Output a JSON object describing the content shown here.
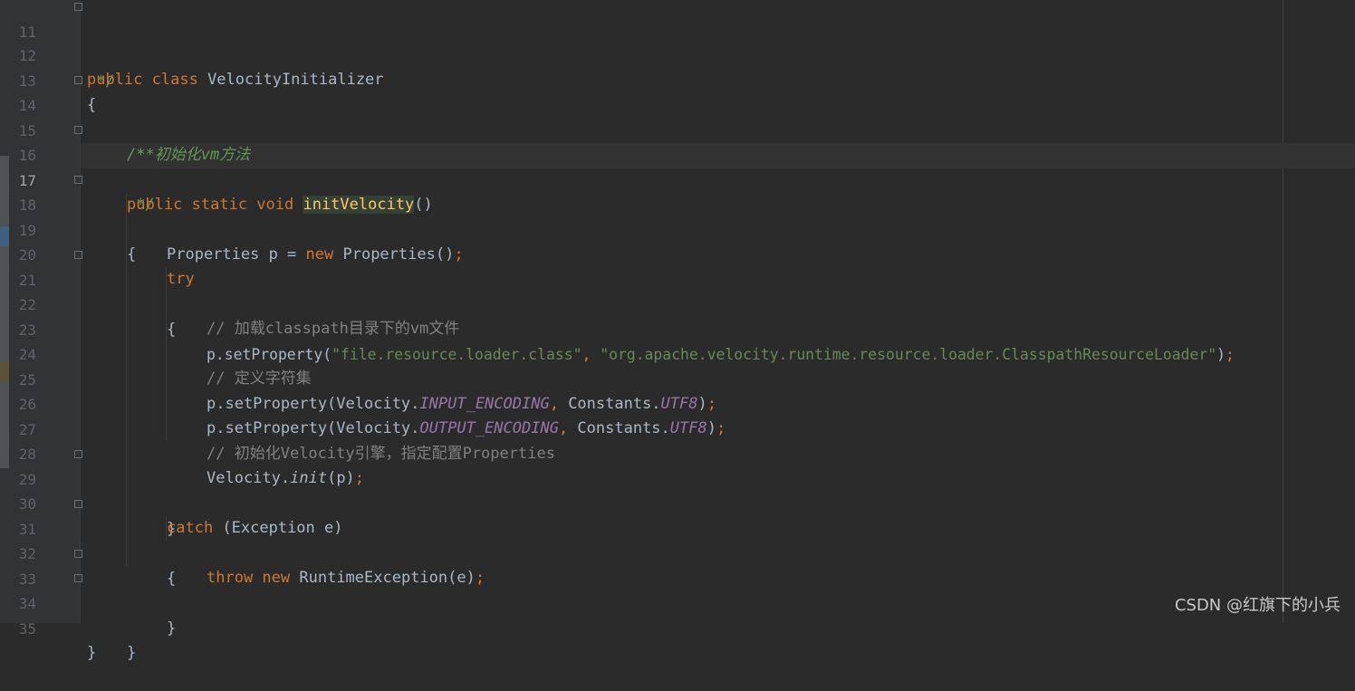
{
  "editor": {
    "line_numbers": [
      "11",
      "12",
      "13",
      "14",
      "15",
      "16",
      "17",
      "18",
      "19",
      "20",
      "21",
      "22",
      "23",
      "24",
      "25",
      "26",
      "27",
      "28",
      "29",
      "30",
      "31",
      "32",
      "33",
      "34",
      "35"
    ],
    "active_line": "17",
    "lines": {
      "l11": {
        "doc": " */"
      },
      "l12": {
        "kw": "public class ",
        "name": "VelocityInitializer"
      },
      "l13": {
        "text": "{"
      },
      "l14": {
        "doc": "/**"
      },
      "l15": {
        "doc": " * 初始化vm方法"
      },
      "l16": {
        "doc": " */"
      },
      "l17": {
        "kw": "public static void ",
        "fn": "initVelocity",
        "rest": "()"
      },
      "l18": {
        "text": "{"
      },
      "l19": {
        "a": "Properties p = ",
        "kw": "new ",
        "b": "Properties()",
        "semi": ";"
      },
      "l20": {
        "kw": "try"
      },
      "l21": {
        "text": "{"
      },
      "l22": {
        "comment": "// 加载classpath目录下的vm文件"
      },
      "l23": {
        "a": "p.setProperty(",
        "s1": "\"file.resource.loader.class\"",
        "comma": ", ",
        "s2": "\"org.apache.velocity.runtime.resource.loader.ClasspathResourceLoader\"",
        "b": ")",
        "semi": ";"
      },
      "l24": {
        "comment": "// 定义字符集"
      },
      "l25": {
        "a": "p.setProperty(Velocity.",
        "c1": "INPUT_ENCODING",
        "comma": ", ",
        "b": "Constants.",
        "c2": "UTF8",
        "d": ")",
        "semi": ";"
      },
      "l26": {
        "a": "p.setProperty(Velocity.",
        "c1": "OUTPUT_ENCODING",
        "comma": ", ",
        "b": "Constants.",
        "c2": "UTF8",
        "d": ")",
        "semi": ";"
      },
      "l27": {
        "comment": "// 初始化Velocity引擎，指定配置Properties"
      },
      "l28": {
        "a": "Velocity.",
        "it": "init",
        "b": "(p)",
        "semi": ";"
      },
      "l29": {
        "text": "}"
      },
      "l30": {
        "kw": "catch ",
        "rest": "(Exception e)"
      },
      "l31": {
        "text": "{"
      },
      "l32": {
        "kw1": "throw ",
        "kw2": "new ",
        "rest": "RuntimeException(e)",
        "semi": ";"
      },
      "l33": {
        "text": "}"
      },
      "l34": {
        "text": "}"
      },
      "l35": {
        "text": "}"
      }
    }
  },
  "watermark": "CSDN @红旗下的小兵",
  "colors": {
    "background": "#2b2b2b",
    "keyword": "#cc7832",
    "string": "#6a8759",
    "doc_comment": "#629755",
    "line_comment": "#808080",
    "constant": "#9876aa",
    "method": "#ffc66d",
    "text": "#a9b7c6"
  }
}
